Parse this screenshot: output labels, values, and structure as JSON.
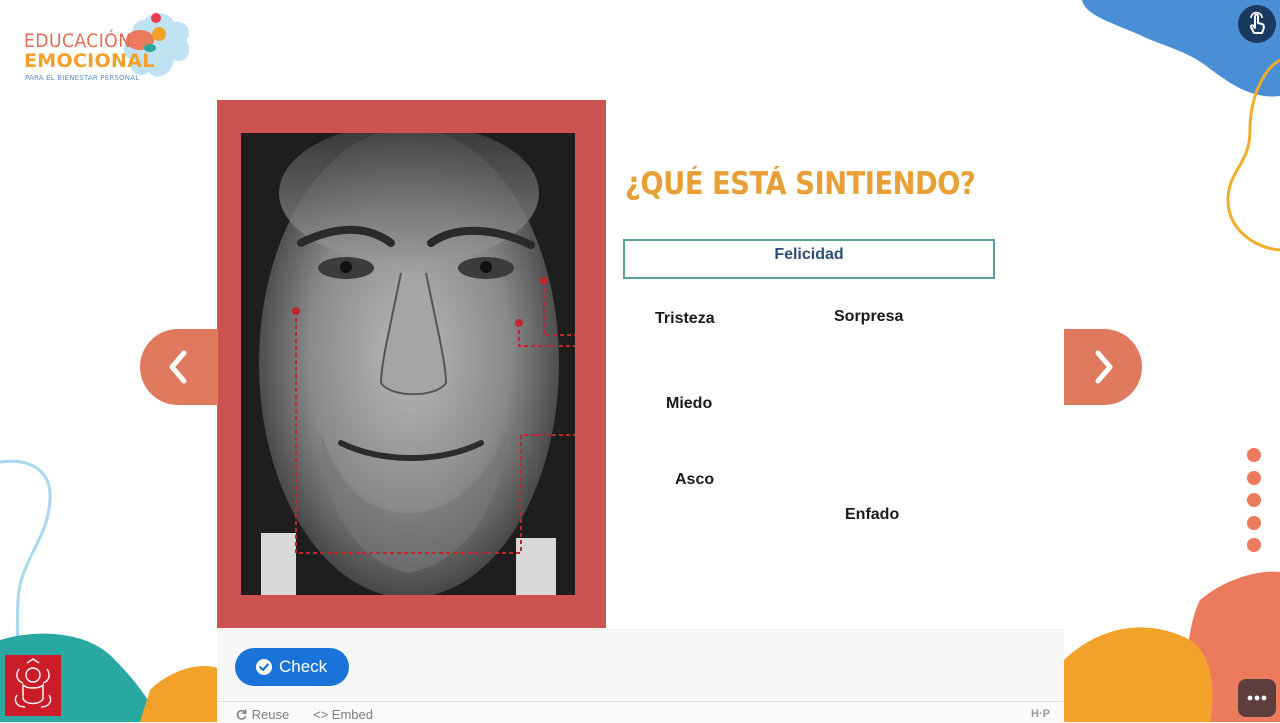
{
  "logo": {
    "line1": "EDUCACIÓN",
    "line2": "EMOCIONAL",
    "line3": "PARA EL BIENESTAR PERSONAL"
  },
  "activity": {
    "title": "¿QUÉ ESTÁ SINTIENDO?",
    "drop_zone_answer": "Felicidad",
    "options": [
      "Tristeza",
      "Sorpresa",
      "Miedo",
      "Asco",
      "Enfado"
    ]
  },
  "controls": {
    "check_label": "Check",
    "reuse_label": "Reuse",
    "embed_label": "<> Embed",
    "h5p_label": "H·P"
  },
  "navigation": {
    "slide_dot_count": 5
  },
  "colors": {
    "frame_red": "#cd5353",
    "title_orange": "#e8a036",
    "drop_zone_border": "#5ba09b",
    "check_blue": "#1a73d9",
    "arrow_coral": "#e07a5f",
    "dot_coral": "#ec7a5c"
  },
  "icons": {
    "prev": "chevron-left-icon",
    "next": "chevron-right-icon",
    "check": "checkmark-circle-icon",
    "reuse": "refresh-icon",
    "touch": "touch-hand-icon",
    "more": "more-dots-icon"
  }
}
